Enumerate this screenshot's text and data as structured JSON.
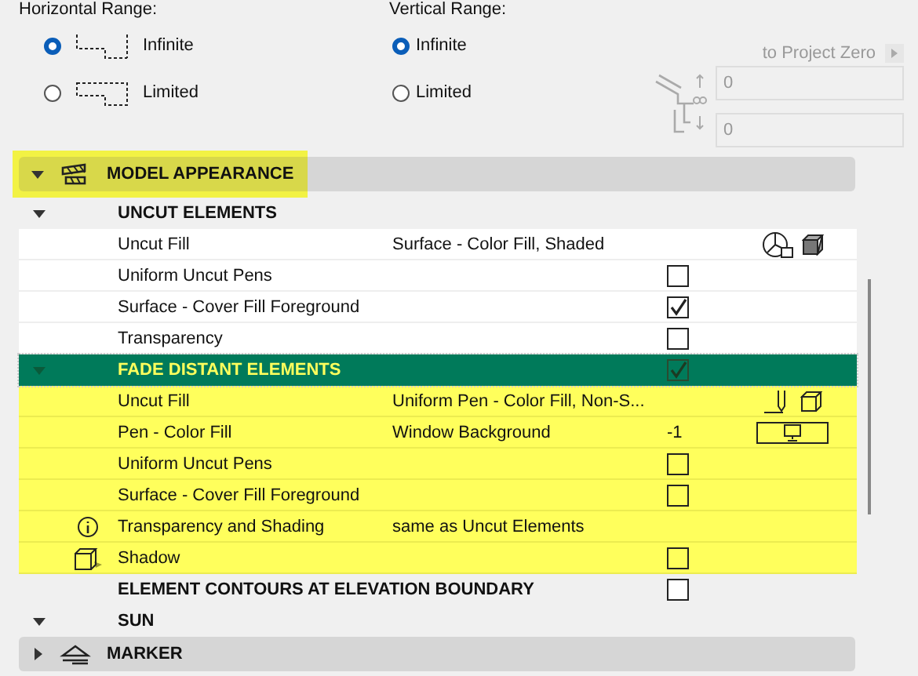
{
  "ranges": [
    {
      "label": "Horizontal Range:",
      "options": [
        {
          "label": "Infinite",
          "selected": true,
          "kind": "infinite"
        },
        {
          "label": "Limited",
          "selected": false,
          "kind": "limited"
        }
      ]
    },
    {
      "label": "Vertical Range:",
      "options": [
        {
          "label": "Infinite",
          "selected": true
        },
        {
          "label": "Limited",
          "selected": false
        }
      ]
    }
  ],
  "project_zero": {
    "label": "to Project Zero",
    "fields": [
      "0",
      "0"
    ]
  },
  "sections": [
    {
      "title": "MODEL APPEARANCE",
      "expanded": true,
      "highlighted": true
    },
    {
      "title": "MARKER",
      "expanded": false,
      "highlighted": false
    }
  ],
  "tree": [
    {
      "kind": "group",
      "label": "UNCUT ELEMENTS",
      "expanded": true,
      "selected": false,
      "highlighted": false,
      "children": [
        {
          "kind": "fill",
          "label": "Uncut Fill",
          "value": "Surface - Color Fill, Shaded"
        },
        {
          "kind": "check",
          "label": "Uniform Uncut Pens",
          "checked": false
        },
        {
          "kind": "check",
          "label": "Surface - Cover Fill Foreground",
          "checked": true
        },
        {
          "kind": "check",
          "label": "Transparency",
          "checked": false
        }
      ]
    },
    {
      "kind": "group",
      "label": "FADE DISTANT ELEMENTS",
      "expanded": true,
      "selected": true,
      "highlighted": true,
      "checked": true,
      "children": [
        {
          "kind": "uniform",
          "label": "Uncut Fill",
          "value": "Uniform Pen - Color Fill, Non-S..."
        },
        {
          "kind": "pen",
          "label": "Pen - Color Fill",
          "value": "Window Background",
          "number": "-1"
        },
        {
          "kind": "check",
          "label": "Uniform Uncut Pens",
          "checked": false
        },
        {
          "kind": "check",
          "label": "Surface - Cover Fill Foreground",
          "checked": false
        },
        {
          "kind": "info",
          "label": "Transparency and Shading",
          "value": "same as Uncut Elements"
        },
        {
          "kind": "shadow",
          "label": "Shadow",
          "checked": false
        }
      ]
    },
    {
      "kind": "group",
      "label": "ELEMENT CONTOURS AT ELEVATION BOUNDARY",
      "selected": false,
      "highlighted": false,
      "checked": false
    },
    {
      "kind": "group",
      "label": "SUN",
      "expanded": true,
      "selected": false,
      "highlighted": false
    }
  ]
}
